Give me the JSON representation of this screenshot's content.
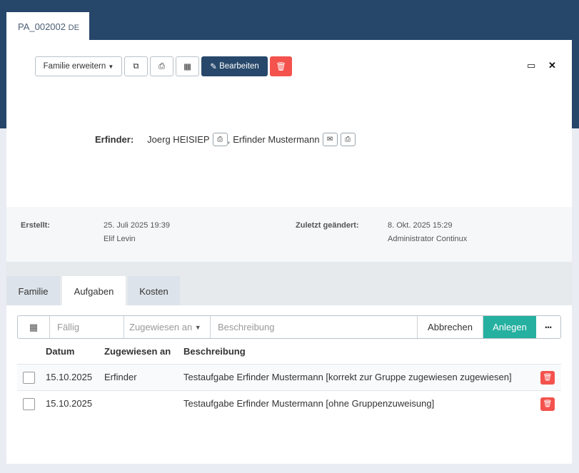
{
  "patent": {
    "id": "PA_002002",
    "country": "DE"
  },
  "toolbar": {
    "family_extend": "Familie erweitern",
    "edit": "Bearbeiten"
  },
  "inventors": {
    "label": "Erfinder:",
    "items": [
      "Joerg HEISIEP",
      "Erfinder Mustermann"
    ],
    "separator": ","
  },
  "meta": {
    "created_label": "Erstellt:",
    "created_date": "25. Juli 2025 19:39",
    "created_by": "Elif Levin",
    "modified_label": "Zuletzt geändert:",
    "modified_date": "8. Okt. 2025 15:29",
    "modified_by": "Administrator Continux"
  },
  "tabs": [
    {
      "label": "Familie"
    },
    {
      "label": "Aufgaben"
    },
    {
      "label": "Kosten"
    }
  ],
  "task_form": {
    "due_placeholder": "Fällig",
    "assigned_placeholder": "Zugewiesen an",
    "description_placeholder": "Beschreibung",
    "cancel": "Abbrechen",
    "create": "Anlegen",
    "more": "•••"
  },
  "table": {
    "headers": [
      "Datum",
      "Zugewiesen an",
      "Beschreibung"
    ],
    "rows": [
      {
        "date": "15.10.2025",
        "assigned": "Erfinder",
        "description": "Testaufgabe Erfinder Mustermann [korrekt zur Gruppe zugewiesen zugewiesen]"
      },
      {
        "date": "15.10.2025",
        "assigned": "",
        "description": "Testaufgabe Erfinder Mustermann [ohne Gruppenzuweisung]"
      }
    ]
  },
  "colors": {
    "navy": "#26466a",
    "danger": "#f4524d",
    "teal": "#26b0a0"
  }
}
